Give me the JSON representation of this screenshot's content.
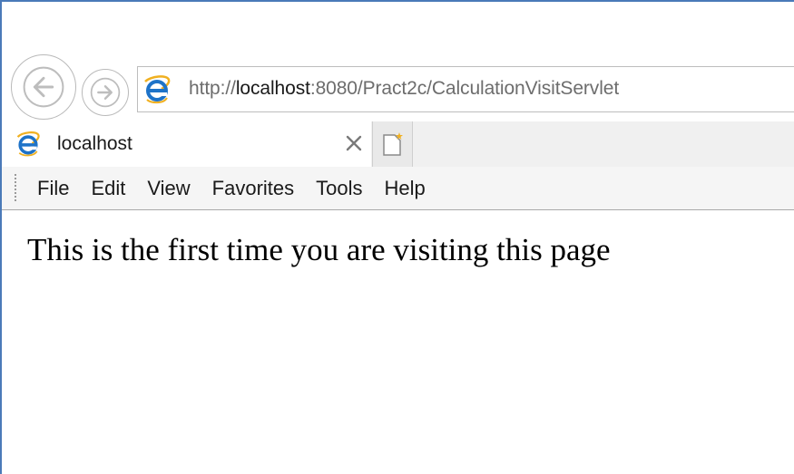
{
  "address_bar": {
    "url_prefix": "http://",
    "url_host": "localhost",
    "url_rest": ":8080/Pract2c/CalculationVisitServlet"
  },
  "tabs": [
    {
      "label": "localhost"
    }
  ],
  "menu": {
    "items": [
      "File",
      "Edit",
      "View",
      "Favorites",
      "Tools",
      "Help"
    ]
  },
  "content": {
    "message": "This is the first time you are visiting this page"
  },
  "icons": {
    "back": "back-arrow-icon",
    "forward": "forward-arrow-icon",
    "site": "internet-explorer-icon",
    "close": "close-icon",
    "new_tab": "new-tab-icon"
  },
  "colors": {
    "ie_blue": "#1e73c8",
    "ie_gold": "#f0b020",
    "window_border": "#4a7ab8"
  }
}
